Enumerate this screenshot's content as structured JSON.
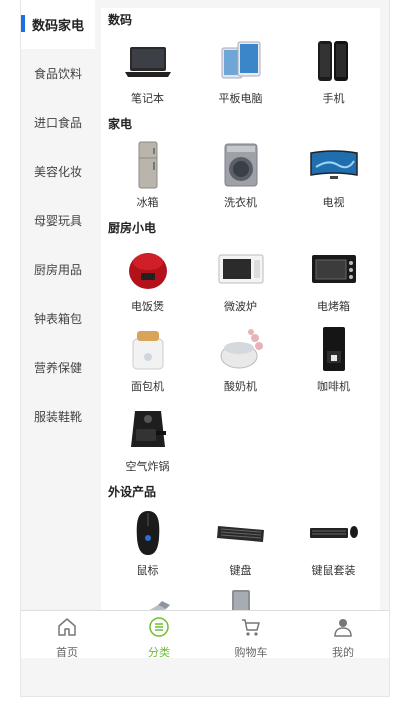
{
  "sidebar": {
    "items": [
      {
        "label": "数码家电",
        "active": true
      },
      {
        "label": "食品饮料"
      },
      {
        "label": "进口食品"
      },
      {
        "label": "美容化妆"
      },
      {
        "label": "母婴玩具"
      },
      {
        "label": "厨房用品"
      },
      {
        "label": "钟表箱包"
      },
      {
        "label": "营养保健"
      },
      {
        "label": "服装鞋靴"
      }
    ]
  },
  "sections": [
    {
      "title": "数码",
      "items": [
        {
          "label": "笔记本",
          "icon": "laptop-icon"
        },
        {
          "label": "平板电脑",
          "icon": "tablet-icon"
        },
        {
          "label": "手机",
          "icon": "phone-icon"
        }
      ]
    },
    {
      "title": "家电",
      "items": [
        {
          "label": "冰箱",
          "icon": "fridge-icon"
        },
        {
          "label": "洗衣机",
          "icon": "washer-icon"
        },
        {
          "label": "电视",
          "icon": "tv-icon"
        }
      ]
    },
    {
      "title": "厨房小电",
      "items": [
        {
          "label": "电饭煲",
          "icon": "rice-cooker-icon"
        },
        {
          "label": "微波炉",
          "icon": "microwave-icon"
        },
        {
          "label": "电烤箱",
          "icon": "oven-icon"
        },
        {
          "label": "面包机",
          "icon": "bread-maker-icon"
        },
        {
          "label": "酸奶机",
          "icon": "yogurt-maker-icon"
        },
        {
          "label": "咖啡机",
          "icon": "coffee-machine-icon"
        },
        {
          "label": "空气炸锅",
          "icon": "air-fryer-icon"
        }
      ]
    },
    {
      "title": "外设产品",
      "items": [
        {
          "label": "鼠标",
          "icon": "mouse-icon"
        },
        {
          "label": "键盘",
          "icon": "keyboard-icon"
        },
        {
          "label": "键鼠套装",
          "icon": "keyboard-mouse-set-icon"
        },
        {
          "label": "",
          "icon": "usb-drive-icon"
        },
        {
          "label": "",
          "icon": "hard-drive-icon"
        }
      ]
    }
  ],
  "tabbar": {
    "tabs": [
      {
        "label": "首页",
        "icon": "home-icon"
      },
      {
        "label": "分类",
        "icon": "category-icon",
        "active": true
      },
      {
        "label": "购物车",
        "icon": "cart-icon"
      },
      {
        "label": "我的",
        "icon": "user-icon"
      }
    ]
  },
  "colors": {
    "accent": "#1e6fe0",
    "tab_active": "#6cbf2f"
  }
}
